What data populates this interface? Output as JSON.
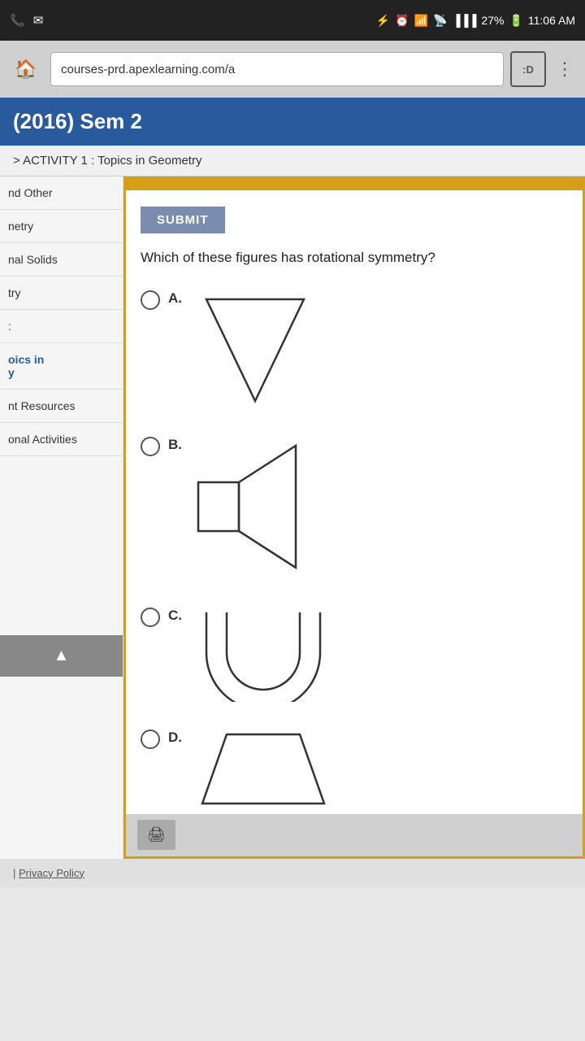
{
  "statusBar": {
    "time": "11:06 AM",
    "battery": "27%",
    "signal": "●●●●",
    "icons": [
      "phone-icon",
      "email-icon",
      "bluetooth-icon",
      "alarm-icon",
      "wifi-icon",
      "network-icon"
    ]
  },
  "browser": {
    "url": "courses-prd.apexlearning.com/a",
    "tabLabel": ":D",
    "homeIcon": "🏠"
  },
  "titleBar": {
    "text": "(2016) Sem 2"
  },
  "breadcrumb": {
    "text": "> ACTIVITY 1 : Topics in Geometry"
  },
  "sidebar": {
    "items": [
      {
        "label": "nd Other",
        "active": false
      },
      {
        "label": "netry",
        "active": false
      },
      {
        "label": "nal Solids",
        "active": false
      },
      {
        "label": "try",
        "active": false
      },
      {
        "label": ":",
        "active": false
      },
      {
        "label": "oics in\ny",
        "active": true,
        "highlighted": true
      },
      {
        "label": "nt Resources",
        "active": false
      },
      {
        "label": "onal Activities",
        "active": false
      }
    ],
    "uploadIcon": "▲"
  },
  "content": {
    "submitLabel": "SUBMIT",
    "questionText": "Which of these figures has rotational symmetry?",
    "options": [
      {
        "id": "A",
        "label": "A."
      },
      {
        "id": "B",
        "label": "B."
      },
      {
        "id": "C",
        "label": "C."
      },
      {
        "id": "D",
        "label": "D."
      }
    ]
  },
  "footer": {
    "printIcon": "🖨",
    "links": [
      {
        "label": "Privacy Policy"
      }
    ],
    "separator": "|"
  }
}
